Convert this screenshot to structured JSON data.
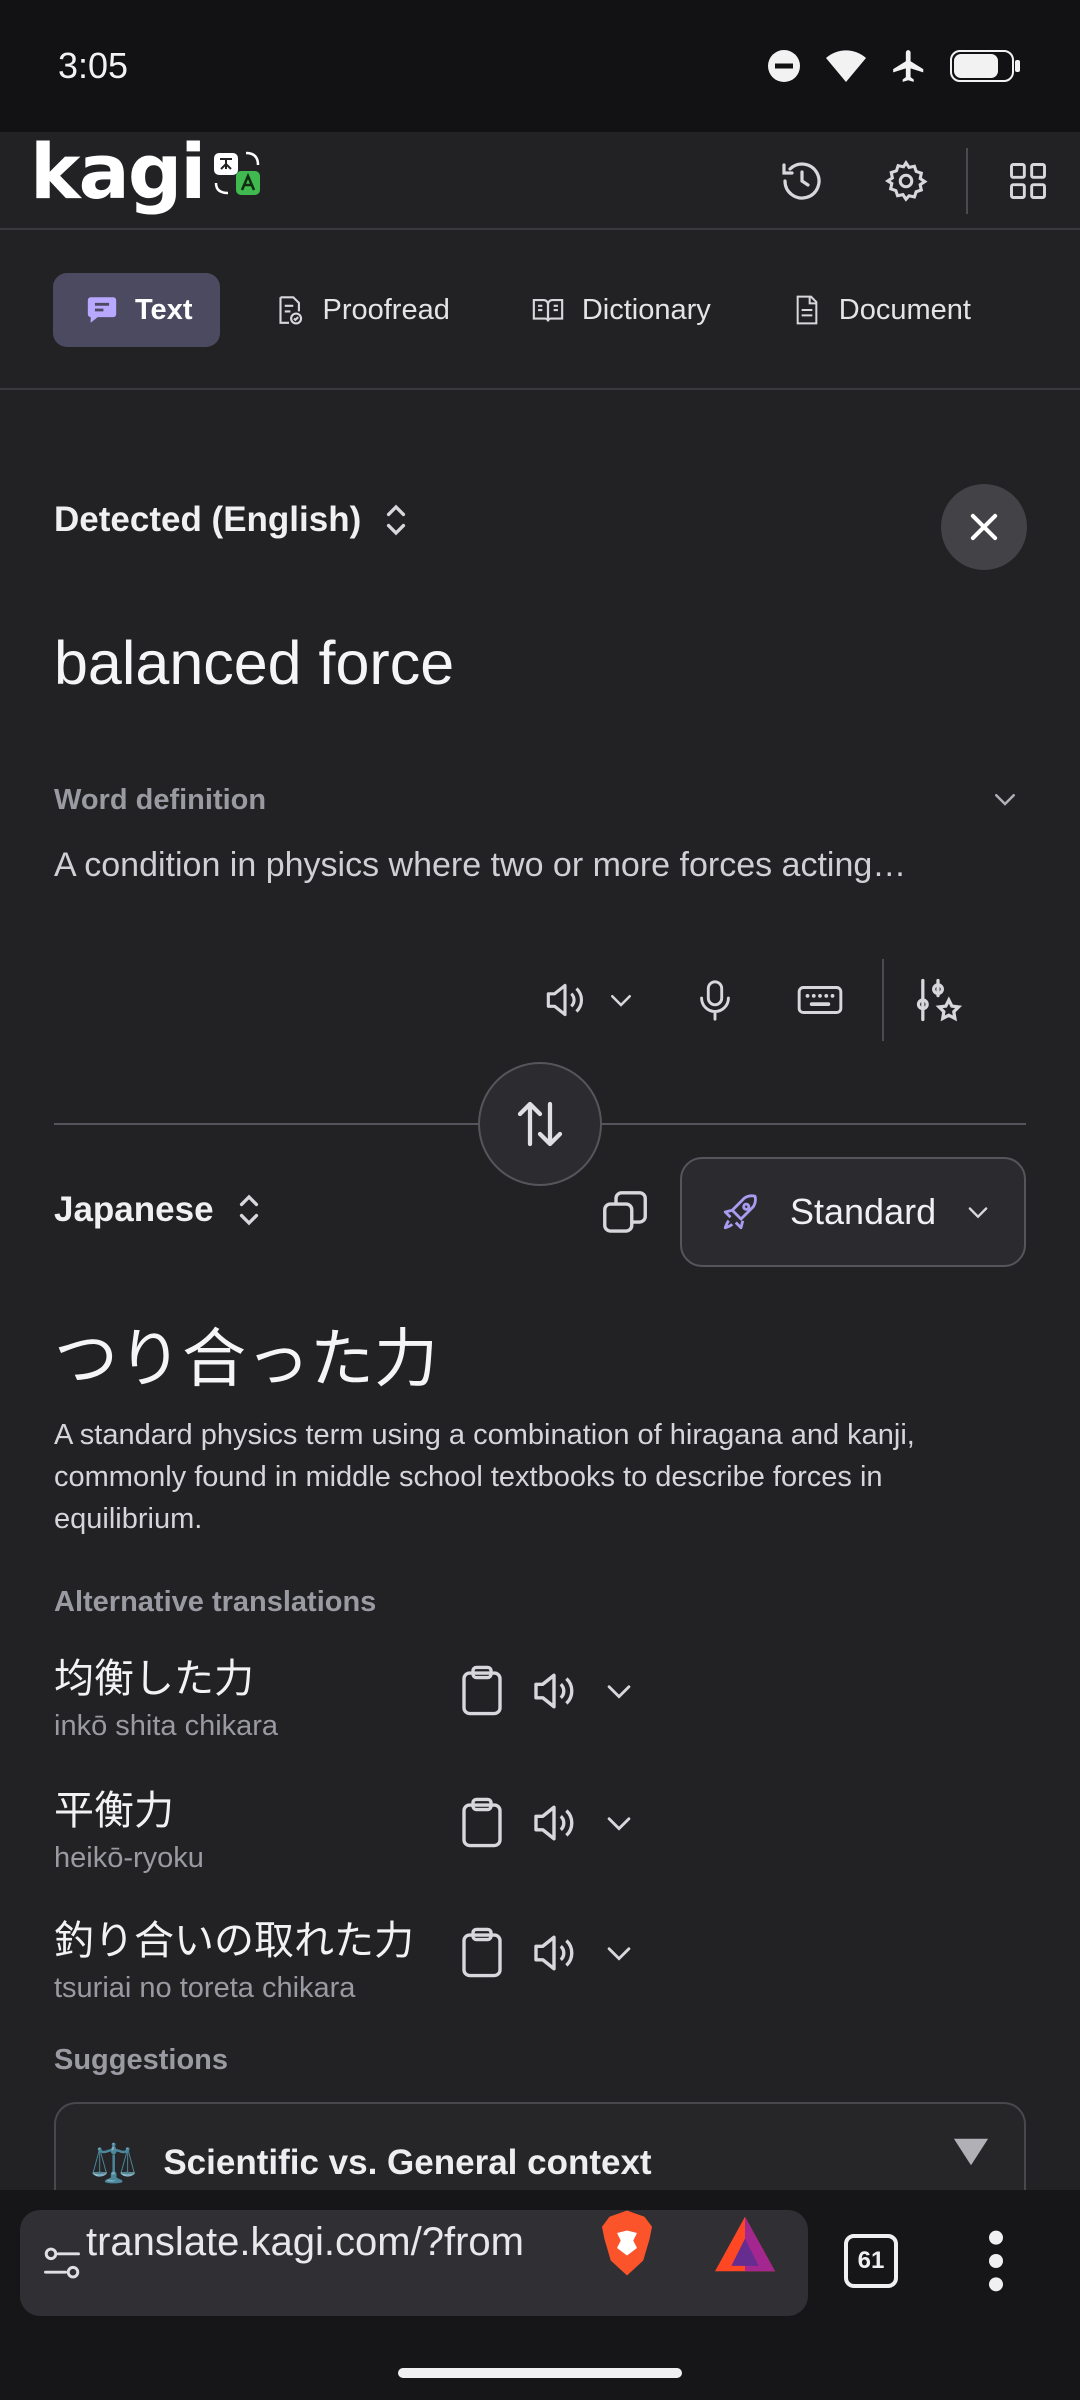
{
  "status_bar": {
    "time": "3:05"
  },
  "header": {
    "logo": "kagi"
  },
  "tabs": [
    {
      "label": "Text",
      "active": true
    },
    {
      "label": "Proofread",
      "active": false
    },
    {
      "label": "Dictionary",
      "active": false
    },
    {
      "label": "Document",
      "active": false
    }
  ],
  "source": {
    "language": "Detected (English)",
    "text": "balanced force",
    "definition_label": "Word definition",
    "definition_text": "A condition in physics where two or more forces acting…"
  },
  "target": {
    "language": "Japanese",
    "model": "Standard",
    "text": "つり合った力",
    "note": "A standard physics term using a combination of hiragana and kanji, commonly found in middle school textbooks to describe forces in equilibrium.",
    "alternatives_label": "Alternative translations",
    "alternatives": [
      {
        "word": "均衡した力",
        "romaji": "inkō shita chikara"
      },
      {
        "word": "平衡力",
        "romaji": "heikō-ryoku"
      },
      {
        "word": "釣り合いの取れた力",
        "romaji": "tsuriai no toreta chikara"
      }
    ],
    "suggestions_label": "Suggestions",
    "suggestion": {
      "icon": "⚖️",
      "title": "Scientific vs. General context"
    }
  },
  "browser": {
    "url": "translate.kagi.com/?from",
    "tab_count": "61"
  },
  "colors": {
    "background": "#222225",
    "active_tab": "#4c4a60",
    "accent_purple": "#a99cf0"
  }
}
